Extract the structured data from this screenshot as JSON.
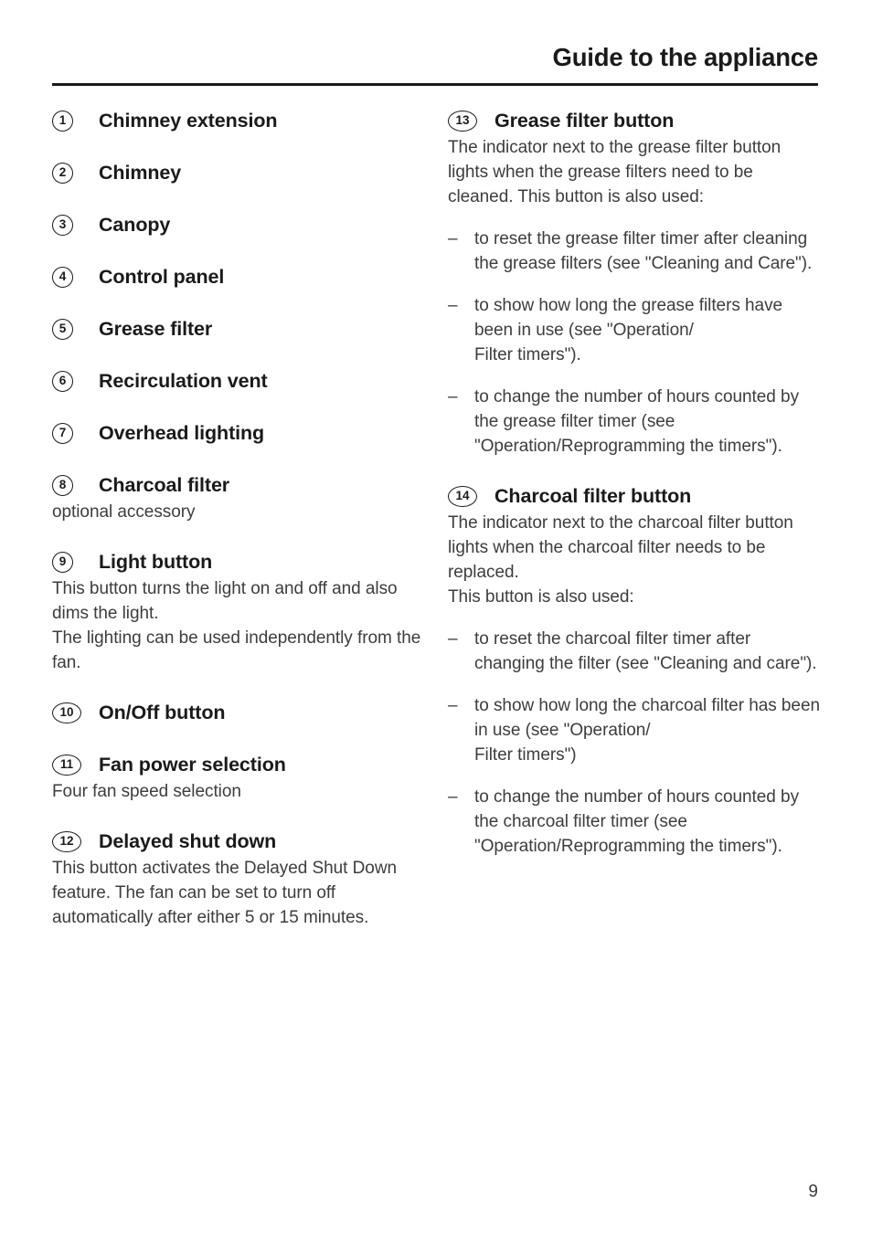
{
  "header": {
    "title": "Guide to the appliance"
  },
  "left_column": {
    "items": [
      {
        "number": "1",
        "title": "Chimney extension"
      },
      {
        "number": "2",
        "title": "Chimney"
      },
      {
        "number": "3",
        "title": "Canopy"
      },
      {
        "number": "4",
        "title": "Control panel"
      },
      {
        "number": "5",
        "title": "Grease filter"
      },
      {
        "number": "6",
        "title": "Recirculation vent"
      },
      {
        "number": "7",
        "title": "Overhead lighting"
      },
      {
        "number": "8",
        "title": "Charcoal filter"
      },
      {
        "number": "9",
        "title": "Light button"
      },
      {
        "number": "10",
        "title": "On/Off button"
      },
      {
        "number": "11",
        "title": "Fan power selection"
      },
      {
        "number": "12",
        "title": "Delayed shut down"
      }
    ],
    "charcoal_filter_note": "optional accessory",
    "light_button_para_1": "This button turns the light on and off and also dims the light.",
    "light_button_para_2": "The lighting can be used independently from the fan.",
    "fan_power_note": "Four fan speed selection",
    "delayed_shut_down_para": "This button activates the Delayed Shut Down feature. The fan can be set to turn off automatically after either 5 or 15 minutes."
  },
  "right_column": {
    "items": [
      {
        "number": "13",
        "title": "Grease filter button"
      },
      {
        "number": "14",
        "title": "Charcoal filter button"
      }
    ],
    "grease_filter_intro": "The indicator next to the grease filter button lights when the grease filters need to be cleaned. This button is also used:",
    "grease_filter_bullets": [
      "to reset the grease filter timer after cleaning the grease filters (see \"Cleaning and Care\").",
      "to show how long the grease filters have been in use (see \"Operation/\nFilter timers\").",
      "to change the number of hours counted by the grease filter timer (see \"Operation/Reprogramming the timers\")."
    ],
    "charcoal_filter_intro": "The indicator next to the charcoal filter button lights when the charcoal filter needs to be replaced.",
    "charcoal_filter_also": "This button is also used:",
    "charcoal_filter_bullets": [
      "to reset the charcoal filter timer after changing the filter (see \"Cleaning and care\").",
      "to show how long the charcoal filter has been in use (see \"Operation/\nFilter timers\")",
      "to change the number of hours counted by the charcoal filter timer (see \"Operation/Reprogramming the timers\")."
    ],
    "bullet_dash": "–"
  },
  "footer": {
    "page_number": "9"
  }
}
